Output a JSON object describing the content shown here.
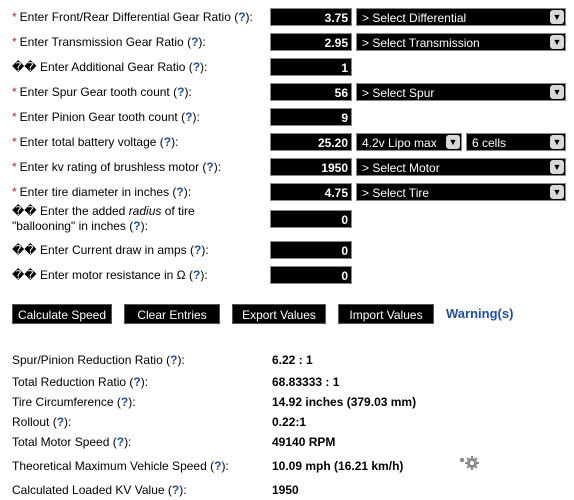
{
  "inputs": [
    {
      "required": true,
      "mark": "*",
      "pre": "Enter Front/Rear Differential Gear Ratio (",
      "help": "?",
      "post": "):",
      "value": "3.75",
      "select": "> Select Differential"
    },
    {
      "required": true,
      "mark": "*",
      "pre": "Enter Transmission Gear Ratio (",
      "help": "?",
      "post": "):",
      "value": "2.95",
      "select": "> Select Transmission"
    },
    {
      "required": false,
      "mark": "��",
      "pre": "Enter Additional Gear Ratio (",
      "help": "?",
      "post": "):",
      "value": "1"
    },
    {
      "required": true,
      "mark": "*",
      "pre": "Enter Spur Gear tooth count (",
      "help": "?",
      "post": "):",
      "value": "56",
      "select": "> Select Spur"
    },
    {
      "required": true,
      "mark": "*",
      "pre": "Enter Pinion Gear tooth count (",
      "help": "?",
      "post": "):",
      "value": "9"
    },
    {
      "required": true,
      "mark": "*",
      "pre": "Enter total battery voltage (",
      "help": "?",
      "post": "):",
      "value": "25.20",
      "select_lipo": "4.2v Lipo max",
      "select_cells": "6 cells"
    },
    {
      "required": true,
      "mark": "*",
      "pre": "Enter kv rating of brushless motor (",
      "help": "?",
      "post": "):",
      "value": "1950",
      "select": "> Select Motor"
    },
    {
      "required": true,
      "mark": "*",
      "pre": "Enter tire diameter in inches (",
      "help": "?",
      "post": "):",
      "value": "4.75",
      "select": "> Select Tire"
    },
    {
      "required": false,
      "mark": "��",
      "pre_a": "Enter the added ",
      "pre_em": "radius",
      "pre_b": " of tire",
      "line2_pre": "\"ballooning\" in inches (",
      "help": "?",
      "post": "):",
      "value": "0"
    },
    {
      "required": false,
      "mark": "��",
      "pre": "Enter Current draw in amps (",
      "help": "?",
      "post": "):",
      "value": "0"
    },
    {
      "required": false,
      "mark": "��",
      "pre": "Enter motor resistance in Ω (",
      "help": "?",
      "post": "):",
      "value": "0"
    }
  ],
  "buttons": {
    "calculate": "Calculate Speed",
    "clear": "Clear Entries",
    "export": "Export Values",
    "import": "Import Values",
    "warning": "Warning(s)"
  },
  "results": [
    {
      "pre": "Spur/Pinion Reduction Ratio (",
      "help": "?",
      "post": "):",
      "value": "6.22 : 1"
    },
    {
      "pre": "Total Reduction Ratio (",
      "help": "?",
      "post": "):",
      "value": "68.83333 : 1"
    },
    {
      "pre": "Tire Circumference (",
      "help": "?",
      "post": "):",
      "value": "14.92 inches (379.03 mm)"
    },
    {
      "pre": "Rollout (",
      "help": "?",
      "post": "):",
      "value": "0.22:1"
    },
    {
      "pre": "Total Motor Speed (",
      "help": "?",
      "post": "):",
      "value": "49140 RPM"
    },
    {
      "pre": "Theoretical Maximum Vehicle Speed (",
      "help": "?",
      "post": "):",
      "value": "10.09 mph (16.21 km/h)"
    },
    {
      "pre": "Calculated Loaded KV Value (",
      "help": "?",
      "post": "):",
      "value": "1950"
    }
  ],
  "colors": {
    "required_marker": "#cc1f1f",
    "help_link": "#1f4f9a",
    "field_bg": "#000000"
  },
  "icons": {
    "dropdown": "chevron-down-icon",
    "settings": "gear-icon"
  }
}
